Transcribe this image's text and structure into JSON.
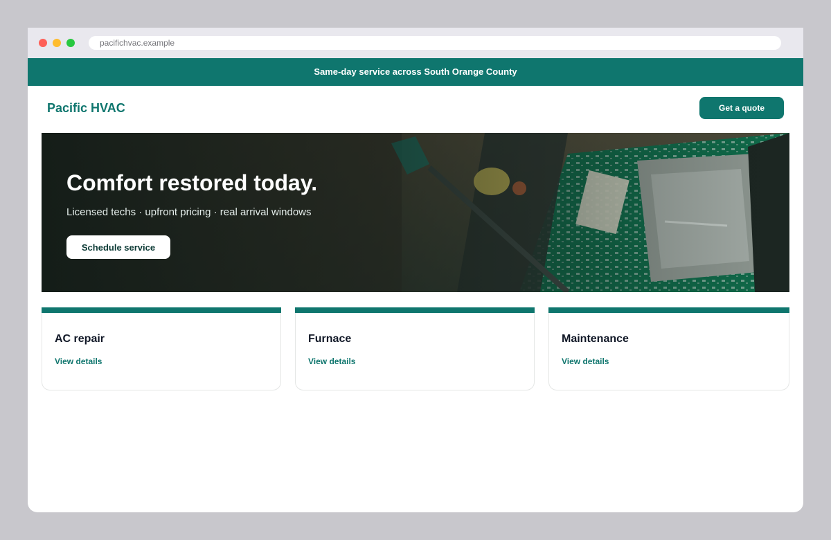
{
  "browser": {
    "url": "pacifichvac.example"
  },
  "announcement": {
    "text": "Same-day service across South Orange County"
  },
  "header": {
    "brand": "Pacific HVAC",
    "cta_label": "Get a quote"
  },
  "hero": {
    "title": "Comfort restored today.",
    "subtitle": "Licensed techs · upfront pricing · real arrival windows",
    "cta_label": "Schedule service"
  },
  "services": [
    {
      "title": "AC repair",
      "link": "View details"
    },
    {
      "title": "Furnace",
      "link": "View details"
    },
    {
      "title": "Maintenance",
      "link": "View details"
    }
  ],
  "colors": {
    "brand": "#0f766e",
    "page_bg": "#c8c7cc",
    "text_dark": "#111827"
  }
}
